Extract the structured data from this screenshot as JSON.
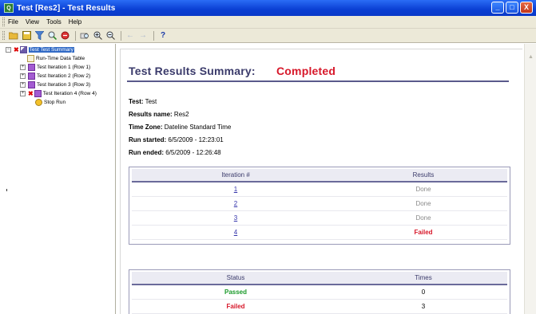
{
  "window": {
    "title": "Test [Res2] - Test Results",
    "app_icon_glyph": "Q"
  },
  "window_buttons": {
    "minimize": "_",
    "maximize": "□",
    "close": "X"
  },
  "menu": [
    "File",
    "View",
    "Tools",
    "Help"
  ],
  "toolbar_icons": [
    "open-folder-icon",
    "save-icon",
    "filter-icon",
    "find-icon",
    "export-icon",
    "print-preview-icon",
    "zoom-in-icon",
    "zoom-out-icon",
    "back-arrow-icon",
    "forward-arrow-icon",
    "help-icon"
  ],
  "tree": {
    "root": "Test Test Summary",
    "items": [
      {
        "label": "Run-Time Data Table",
        "icon": "table-icon",
        "failed": false,
        "expandable": false
      },
      {
        "label": "Test Iteration 1 (Row 1)",
        "icon": "iteration-icon",
        "failed": false,
        "expandable": true
      },
      {
        "label": "Test Iteration 2 (Row 2)",
        "icon": "iteration-icon",
        "failed": false,
        "expandable": true
      },
      {
        "label": "Test Iteration 3 (Row 3)",
        "icon": "iteration-icon",
        "failed": false,
        "expandable": true
      },
      {
        "label": "Test Iteration 4 (Row 4)",
        "icon": "iteration-icon",
        "failed": true,
        "expandable": true
      },
      {
        "label": "Stop Run",
        "icon": "stop-run-icon",
        "failed": false,
        "expandable": false
      }
    ]
  },
  "summary": {
    "heading": "Test Results Summary:",
    "status": "Completed",
    "test_label": "Test:",
    "test_value": "Test",
    "results_name_label": "Results name:",
    "results_name_value": "Res2",
    "time_zone_label": "Time Zone:",
    "time_zone_value": "Dateline Standard Time",
    "run_started_label": "Run started:",
    "run_started_value": "6/5/2009 - 12:23:01",
    "run_ended_label": "Run ended:",
    "run_ended_value": "6/5/2009 - 12:26:48"
  },
  "iterations_table": {
    "headers": [
      "Iteration #",
      "Results"
    ],
    "rows": [
      {
        "iteration": "1",
        "result": "Done",
        "status": "done"
      },
      {
        "iteration": "2",
        "result": "Done",
        "status": "done"
      },
      {
        "iteration": "3",
        "result": "Done",
        "status": "done"
      },
      {
        "iteration": "4",
        "result": "Failed",
        "status": "failed"
      }
    ]
  },
  "status_table": {
    "headers": [
      "Status",
      "Times"
    ],
    "rows": [
      {
        "status": "Passed",
        "times": "0",
        "kind": "passed"
      },
      {
        "status": "Failed",
        "times": "3",
        "kind": "failed"
      }
    ]
  },
  "colors": {
    "titlebar": "#0a3fd3",
    "heading": "#3b3b6b",
    "completed": "#d7182a",
    "passed": "#1a9a2a",
    "failed": "#d7182a",
    "link": "#3333aa"
  }
}
